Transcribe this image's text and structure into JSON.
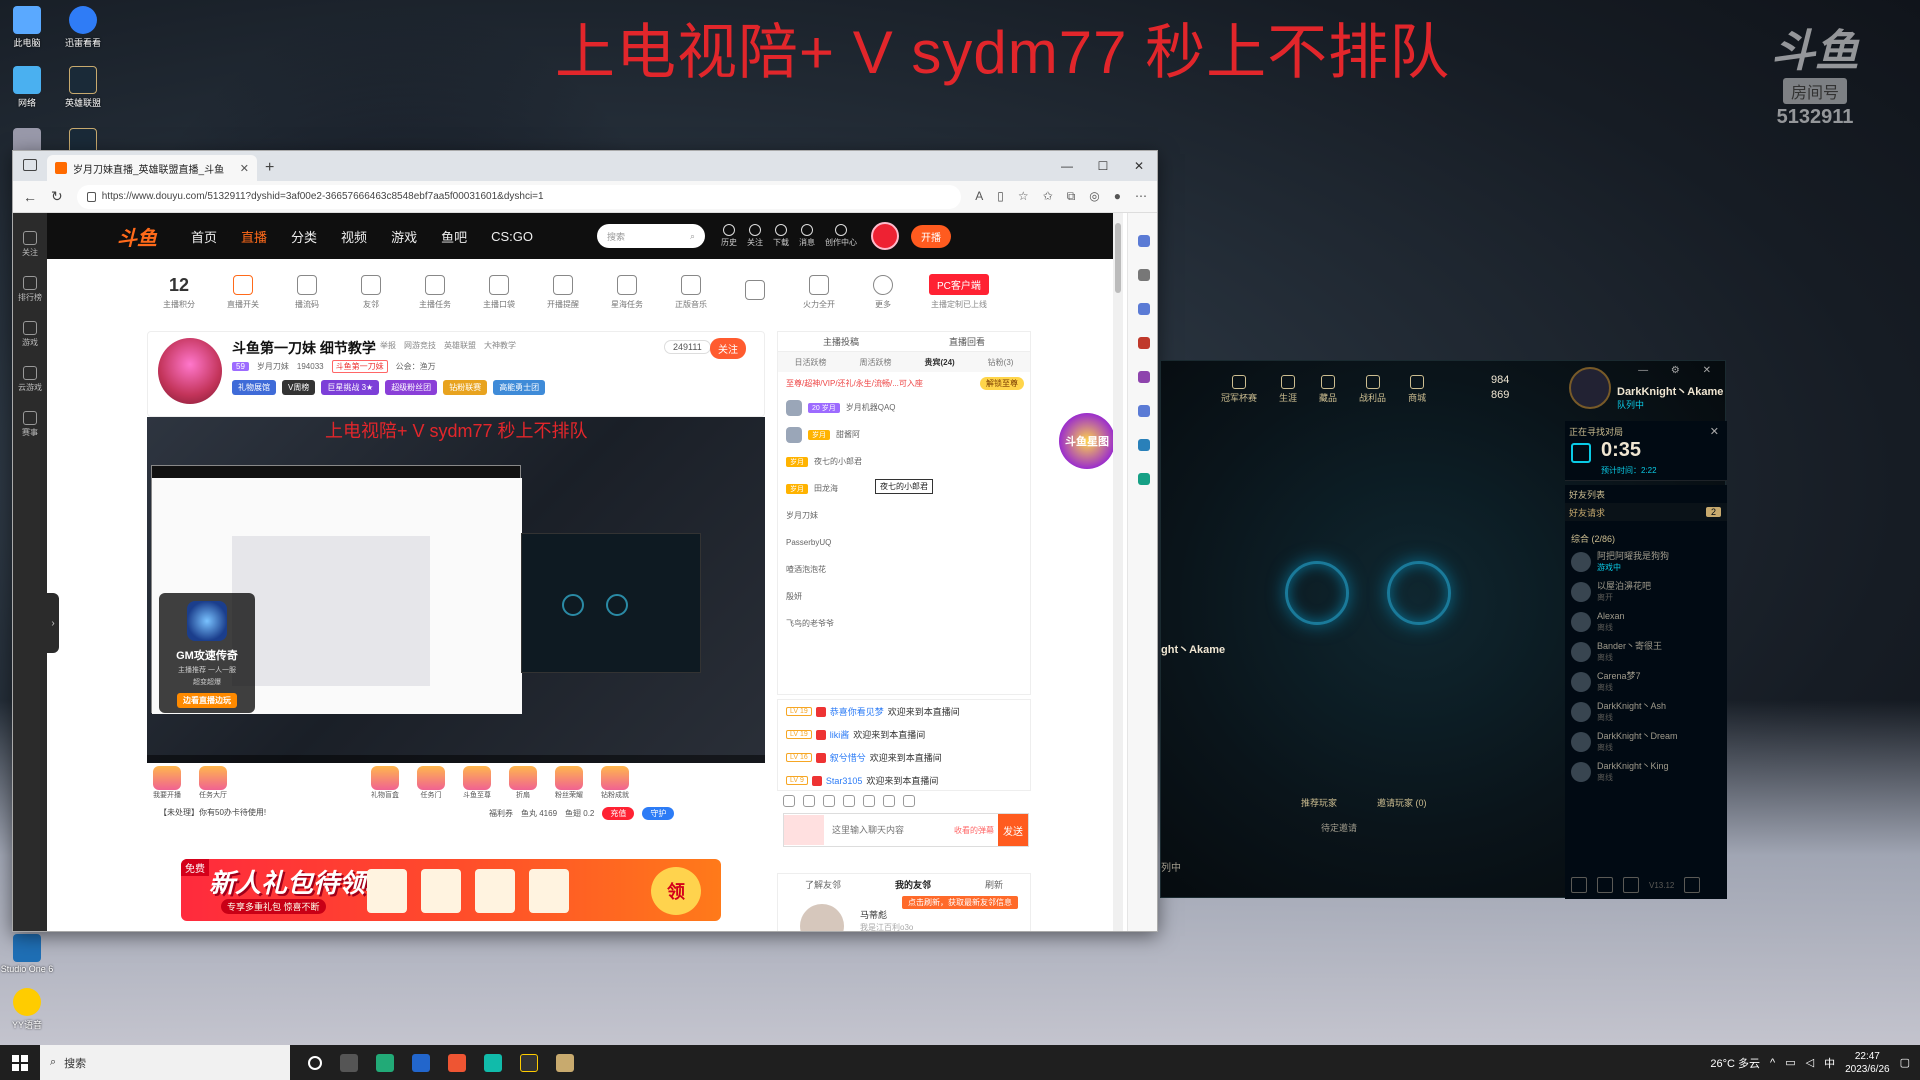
{
  "overlay": {
    "title": "上电视陪+ V sydm77 秒上不排队"
  },
  "watermark": {
    "logo": "斗鱼",
    "tag": "房间号",
    "room": "5132911"
  },
  "browser": {
    "tab_title": "岁月刀妹直播_英雄联盟直播_斗鱼",
    "url": "https://www.douyu.com/5132911?dyshid=3af00e2-36657666463c8548ebf7aa5f00031601&dyshci=1"
  },
  "nav": {
    "logo": "斗鱼",
    "items": [
      "首页",
      "直播",
      "分类",
      "视频",
      "游戏",
      "鱼吧",
      "CS:GO"
    ],
    "search_placeholder": "搜索",
    "icons": [
      "历史",
      "关注",
      "下载",
      "消息",
      "创作中心"
    ],
    "live_btn": "开播"
  },
  "toolbar": {
    "score": "12",
    "score_label": "主播积分",
    "items": [
      "直播开关",
      "播流码",
      "友邻",
      "主播任务",
      "主播口袋",
      "开播提醒",
      "星海任务",
      "正版音乐",
      "",
      "火力全开",
      "更多"
    ],
    "pc_btn": "PC客户端",
    "pc_sub": "主播定制已上线"
  },
  "streamer": {
    "title": "斗鱼第一刀妹 细节教学",
    "meta": [
      "举报",
      "网游竞技",
      "英雄联盟",
      "大神教学"
    ],
    "level": "59",
    "name": "岁月刀妹",
    "heat": "194033",
    "badge": "斗鱼第一刀妹",
    "notice": "公会：渔万",
    "tags": [
      "礼物展馆",
      "V周榜",
      "巨星挑战 3★",
      "超级粉丝团",
      "钻粉联赛",
      "高能勇士团"
    ],
    "count": "249111",
    "follow": "关注"
  },
  "video": {
    "overlay": "上电视陪+ V sydm77 秒上不排队",
    "ad_title": "GM攻速传奇",
    "ad_sub1": "主播推荐",
    "ad_sub2": "一人一服",
    "ad_sub3": "超变超爆",
    "ad_btn": "边看直播边玩"
  },
  "gifts": [
    "我要开播",
    "任务大厅",
    "礼物盲盒",
    "任务门",
    "斗鱼至尊",
    "折扇",
    "粉丝荣耀",
    "钻粉成就"
  ],
  "notice": "【未处理】你有50办卡待使用!",
  "wallet": [
    "福利券",
    "鱼丸 4169",
    "鱼翅 0.2"
  ],
  "wallet_btn": "充值",
  "guard_btn": "守护",
  "banner": {
    "free": "免费",
    "title": "新人礼包待领取",
    "sub": "专享多重礼包 惊喜不断",
    "claim": "领"
  },
  "rank": {
    "top": [
      "主播投稿",
      "直播回看"
    ],
    "tabs": [
      "日活跃榜",
      "周活跃榜",
      "贵宾(24)",
      "钻粉(3)"
    ],
    "promo": "至尊/超神/VIP/还礼/永生/流畅/...可入座",
    "promo_btn": "解锁至尊",
    "items": [
      {
        "lv": "20 岁月",
        "name": "岁月机器QAQ"
      },
      {
        "lv": "岁月",
        "name": "甜酱阿"
      },
      {
        "lv": "岁月",
        "name": "夜七的小郎君"
      },
      {
        "lv": "岁月",
        "name": "田龙海"
      },
      {
        "lv": "",
        "name": "岁月刀妹"
      },
      {
        "lv": "",
        "name": "PasserbyUQ"
      },
      {
        "lv": "",
        "name": "喳酒泡泡花"
      },
      {
        "lv": "",
        "name": "殷妍"
      },
      {
        "lv": "",
        "name": "飞鸟的老爷爷"
      }
    ],
    "tooltip": "夜七的小郎君"
  },
  "chat": [
    {
      "lv": "LV 19",
      "name": "恭喜你看见梦",
      "text": "欢迎来到本直播间"
    },
    {
      "lv": "LV 19",
      "name": "liki酱",
      "text": "欢迎来到本直播间"
    },
    {
      "lv": "LV 16",
      "name": "叙兮惜兮",
      "text": "欢迎来到本直播间"
    },
    {
      "lv": "LV 9",
      "name": "Star3105",
      "text": "欢迎来到本直播间"
    }
  ],
  "chat_input": {
    "placeholder": "这里输入聊天内容",
    "send": "发送",
    "hint": "收看的弹幕"
  },
  "friends": {
    "tabs": [
      "了解友邻",
      "我的友邻",
      "刷新"
    ],
    "tip": "点击刷新，获取最新友邻信息",
    "name": "马蒂彪",
    "status": "我是江百利o3o"
  },
  "float_badge": "斗鱼星图",
  "lol": {
    "topbar": [
      "冠军杯赛",
      "生涯",
      "藏品",
      "战利品",
      "商城"
    ],
    "rp": "984",
    "be": "869",
    "player": "DarkKnight丶Akame",
    "player_status": "队列中",
    "player_level": "79",
    "queue_label": "正在寻找对局",
    "queue_time": "0:35",
    "queue_est": "预计时间：2:22",
    "social_header": "好友列表",
    "requests": "好友请求",
    "req_count": "2",
    "group": "综合 (2/86)",
    "friends": [
      {
        "name": "阿把阿曜我是狗狗",
        "status": "游戏中",
        "ingame": true
      },
      {
        "name": "以屋泊濞花吧",
        "status": "离开",
        "ingame": false
      },
      {
        "name": "Alexan",
        "status": "离线",
        "ingame": false
      },
      {
        "name": "Bander丶寄很王",
        "status": "离线",
        "ingame": false
      },
      {
        "name": "Carena梦7",
        "status": "离线",
        "ingame": false
      },
      {
        "name": "DarkKnight丶Ash",
        "status": "离线",
        "ingame": false
      },
      {
        "name": "DarkKnight丶Dream",
        "status": "离线",
        "ingame": false
      },
      {
        "name": "DarkKnight丶King",
        "status": "离线",
        "ingame": false
      }
    ],
    "left_name": "ght丶Akame",
    "invite_label": "推荐玩家",
    "invite_tab": "邀请玩家 (0)",
    "wait": "待定邀请",
    "bottom": "列中",
    "version": "V13.12"
  },
  "desktop_icons": [
    "此电脑",
    "迅雷看看",
    "网络",
    "英雄联盟",
    "",
    "Studio One 6",
    "YY语音"
  ],
  "taskbar": {
    "search": "搜索",
    "weather": "26°C 多云",
    "ime": "中",
    "time": "22:47",
    "date": "2023/6/26"
  }
}
